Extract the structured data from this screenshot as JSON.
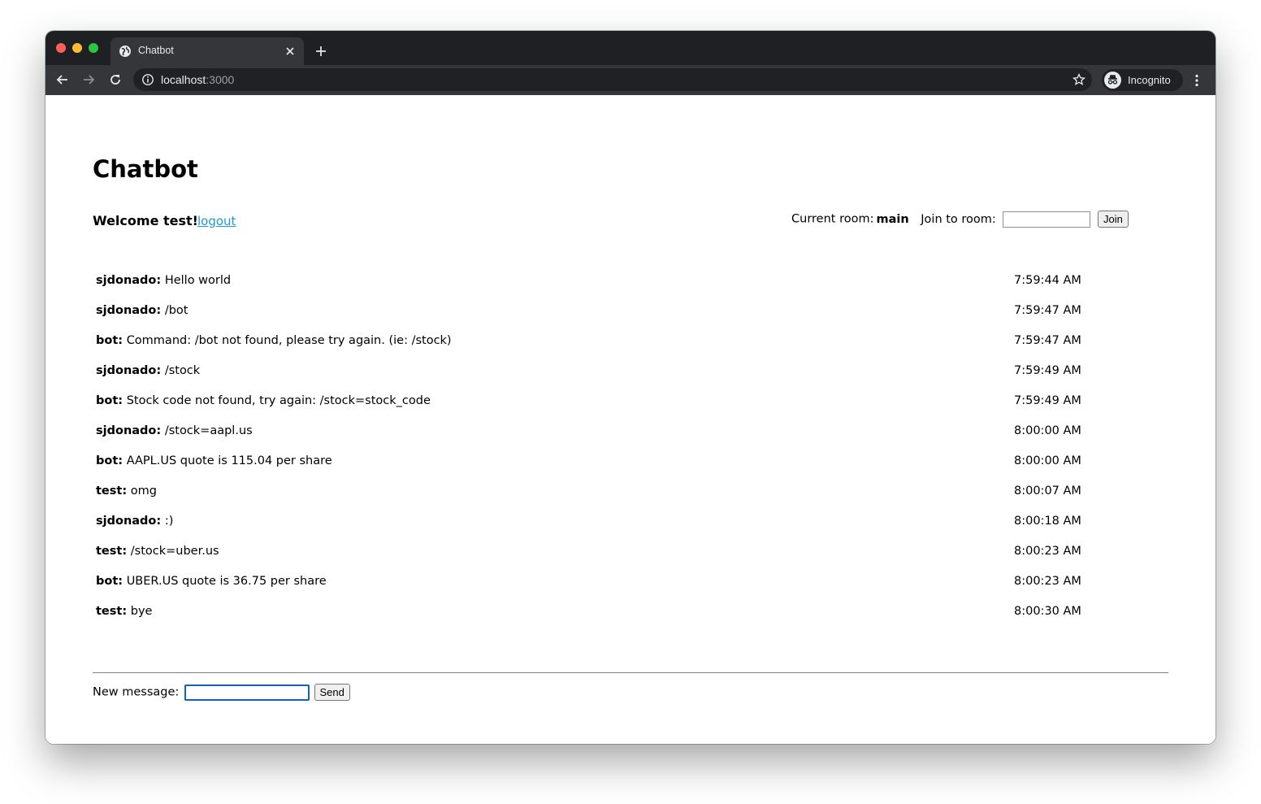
{
  "browser": {
    "tab_title": "Chatbot",
    "url_host": "localhost",
    "url_port": ":3000",
    "profile_label": "Incognito"
  },
  "page": {
    "heading": "Chatbot",
    "welcome": "Welcome test!",
    "logout_label": "logout",
    "current_room_label": "Current room:",
    "current_room": "main",
    "join_label": "Join to room:",
    "join_input_value": "",
    "join_button": "Join",
    "new_message_label": "New message:",
    "new_message_value": "",
    "send_button": "Send"
  },
  "messages": [
    {
      "author": "sjdonado:",
      "text": "Hello world",
      "time": "7:59:44 AM"
    },
    {
      "author": "sjdonado:",
      "text": "/bot",
      "time": "7:59:47 AM"
    },
    {
      "author": "bot:",
      "text": "Command: /bot not found, please try again. (ie: /stock)",
      "time": "7:59:47 AM"
    },
    {
      "author": "sjdonado:",
      "text": "/stock",
      "time": "7:59:49 AM"
    },
    {
      "author": "bot:",
      "text": "Stock code not found, try again: /stock=stock_code",
      "time": "7:59:49 AM"
    },
    {
      "author": "sjdonado:",
      "text": "/stock=aapl.us",
      "time": "8:00:00 AM"
    },
    {
      "author": "bot:",
      "text": "AAPL.US quote is 115.04 per share",
      "time": "8:00:00 AM"
    },
    {
      "author": "test:",
      "text": "omg",
      "time": "8:00:07 AM"
    },
    {
      "author": "sjdonado:",
      "text": ":)",
      "time": "8:00:18 AM"
    },
    {
      "author": "test:",
      "text": "/stock=uber.us",
      "time": "8:00:23 AM"
    },
    {
      "author": "bot:",
      "text": "UBER.US quote is 36.75 per share",
      "time": "8:00:23 AM"
    },
    {
      "author": "test:",
      "text": "bye",
      "time": "8:00:30 AM"
    }
  ],
  "icons": {
    "tab_favicon": "globe-icon",
    "tab_close": "close-icon",
    "new_tab": "plus-icon",
    "back": "arrow-left-icon",
    "forward": "arrow-right-icon",
    "reload": "reload-icon",
    "site_info": "info-icon",
    "bookmark": "star-icon",
    "profile": "incognito-icon",
    "menu": "kebab-menu-icon"
  },
  "colors": {
    "titlebar": "#1f2023",
    "toolbar": "#35363a",
    "omnibox": "#202124",
    "link": "#1a9bd7",
    "focus_ring": "#1560bd"
  }
}
